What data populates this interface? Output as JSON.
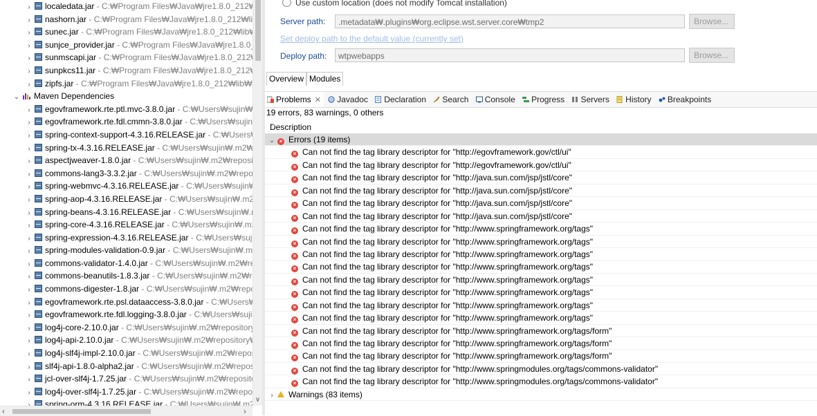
{
  "explorer": {
    "top_items": [
      {
        "name": "localedata.jar",
        "path": " - C:₩Program Files₩Java₩jre1.8.0_212₩li"
      },
      {
        "name": "nashorn.jar",
        "path": " - C:₩Program Files₩Java₩jre1.8.0_212₩lib₩"
      },
      {
        "name": "sunec.jar",
        "path": " - C:₩Program Files₩Java₩jre1.8.0_212₩lib₩e:"
      },
      {
        "name": "sunjce_provider.jar",
        "path": " - C:₩Program Files₩Java₩jre1.8.0_2"
      },
      {
        "name": "sunmscapi.jar",
        "path": " - C:₩Program Files₩Java₩jre1.8.0_212₩li"
      },
      {
        "name": "sunpkcs11.jar",
        "path": " - C:₩Program Files₩Java₩jre1.8.0_212₩li"
      },
      {
        "name": "zipfs.jar",
        "path": " - C:₩Program Files₩Java₩jre1.8.0_212₩lib₩ext"
      }
    ],
    "group_label": "Maven Dependencies",
    "maven_items": [
      {
        "name": "egovframework.rte.ptl.mvc-3.8.0.jar",
        "path": " - C:₩Users₩sujin₩."
      },
      {
        "name": "egovframework.rte.fdl.cmmn-3.8.0.jar",
        "path": " - C:₩Users₩sujin"
      },
      {
        "name": "spring-context-support-4.3.16.RELEASE.jar",
        "path": " - C:₩Users₩"
      },
      {
        "name": "spring-tx-4.3.16.RELEASE.jar",
        "path": " - C:₩Users₩sujin₩.m2₩rep"
      },
      {
        "name": "aspectjweaver-1.8.0.jar",
        "path": " - C:₩Users₩sujin₩.m2₩repositc"
      },
      {
        "name": "commons-lang3-3.3.2.jar",
        "path": " - C:₩Users₩sujin₩.m2₩repos"
      },
      {
        "name": "spring-webmvc-4.3.16.RELEASE.jar",
        "path": " - C:₩Users₩sujin₩.n"
      },
      {
        "name": "spring-aop-4.3.16.RELEASE.jar",
        "path": " - C:₩Users₩sujin₩.m2₩r"
      },
      {
        "name": "spring-beans-4.3.16.RELEASE.jar",
        "path": " - C:₩Users₩sujin₩.m2"
      },
      {
        "name": "spring-core-4.3.16.RELEASE.jar",
        "path": " - C:₩Users₩sujin₩.m2₩"
      },
      {
        "name": "spring-expression-4.3.16.RELEASE.jar",
        "path": " - C:₩Users₩sujin₩"
      },
      {
        "name": "spring-modules-validation-0.9.jar",
        "path": " - C:₩Users₩sujin₩.m"
      },
      {
        "name": "commons-validator-1.4.0.jar",
        "path": " - C:₩Users₩sujin₩.m2₩rep"
      },
      {
        "name": "commons-beanutils-1.8.3.jar",
        "path": " - C:₩Users₩sujin₩.m2₩re"
      },
      {
        "name": "commons-digester-1.8.jar",
        "path": " - C:₩Users₩sujin₩.m2₩repo"
      },
      {
        "name": "egovframework.rte.psl.dataaccess-3.8.0.jar",
        "path": " - C:₩Users₩"
      },
      {
        "name": "egovframework.rte.fdl.logging-3.8.0.jar",
        "path": " - C:₩Users₩suji"
      },
      {
        "name": "log4j-core-2.10.0.jar",
        "path": " - C:₩Users₩sujin₩.m2₩repository₩"
      },
      {
        "name": "log4j-api-2.10.0.jar",
        "path": " - C:₩Users₩sujin₩.m2₩repository₩"
      },
      {
        "name": "log4j-slf4j-impl-2.10.0.jar",
        "path": " - C:₩Users₩sujin₩.m2₩repos"
      },
      {
        "name": "slf4j-api-1.8.0-alpha2.jar",
        "path": " - C:₩Users₩sujin₩.m2₩reposi"
      },
      {
        "name": "jcl-over-slf4j-1.7.25.jar",
        "path": " - C:₩Users₩sujin₩.m2₩reposito"
      },
      {
        "name": "log4j-over-slf4j-1.7.25.jar",
        "path": " - C:₩Users₩sujin₩.m2₩repos"
      },
      {
        "name": "spring-orm-4.3.16.RELEASE.jar",
        "path": " - C:₩Users₩sujin₩.m2₩r"
      }
    ]
  },
  "server": {
    "custom_location": "Use custom location (does not modify Tomcat installation)",
    "server_path_label": "Server path:",
    "server_path_value": ".metadata₩.plugins₩org.eclipse.wst.server.core₩tmp2",
    "browse_label": "Browse...",
    "set_default_link": "Set deploy path to the default value (currently set)",
    "deploy_path_label": "Deploy path:",
    "deploy_path_value": "wtpwebapps",
    "editor_tabs": [
      "Overview",
      "Modules"
    ]
  },
  "views": {
    "tabs": [
      {
        "label": "Problems",
        "icon": "problems-icon",
        "active": true
      },
      {
        "label": "Javadoc",
        "icon": "javadoc-icon"
      },
      {
        "label": "Declaration",
        "icon": "declaration-icon"
      },
      {
        "label": "Search",
        "icon": "search-icon"
      },
      {
        "label": "Console",
        "icon": "console-icon"
      },
      {
        "label": "Progress",
        "icon": "progress-icon"
      },
      {
        "label": "Servers",
        "icon": "servers-icon"
      },
      {
        "label": "History",
        "icon": "history-icon"
      },
      {
        "label": "Breakpoints",
        "icon": "breakpoints-icon"
      }
    ]
  },
  "problems": {
    "summary": "19 errors, 83 warnings, 0 others",
    "column_description": "Description",
    "errors_group": "Errors (19 items)",
    "errors": [
      "Can not find the tag library descriptor for \"http://egovframework.gov/ctl/ui\"",
      "Can not find the tag library descriptor for \"http://egovframework.gov/ctl/ui\"",
      "Can not find the tag library descriptor for \"http://java.sun.com/jsp/jstl/core\"",
      "Can not find the tag library descriptor for \"http://java.sun.com/jsp/jstl/core\"",
      "Can not find the tag library descriptor for \"http://java.sun.com/jsp/jstl/core\"",
      "Can not find the tag library descriptor for \"http://java.sun.com/jsp/jstl/core\"",
      "Can not find the tag library descriptor for \"http://www.springframework.org/tags\"",
      "Can not find the tag library descriptor for \"http://www.springframework.org/tags\"",
      "Can not find the tag library descriptor for \"http://www.springframework.org/tags\"",
      "Can not find the tag library descriptor for \"http://www.springframework.org/tags\"",
      "Can not find the tag library descriptor for \"http://www.springframework.org/tags\"",
      "Can not find the tag library descriptor for \"http://www.springframework.org/tags\"",
      "Can not find the tag library descriptor for \"http://www.springframework.org/tags\"",
      "Can not find the tag library descriptor for \"http://www.springframework.org/tags\"",
      "Can not find the tag library descriptor for \"http://www.springframework.org/tags/form\"",
      "Can not find the tag library descriptor for \"http://www.springframework.org/tags/form\"",
      "Can not find the tag library descriptor for \"http://www.springframework.org/tags/form\"",
      "Can not find the tag library descriptor for \"http://www.springmodules.org/tags/commons-validator\"",
      "Can not find the tag library descriptor for \"http://www.springmodules.org/tags/commons-validator\""
    ],
    "warnings_group": "Warnings (83 items)"
  },
  "colors": {
    "label_blue": "#1a4a9a",
    "link_blue": "#9fbde6",
    "error_red": "#e4463d",
    "warning_yellow": "#e8b01c",
    "group_bg": "#dadada"
  }
}
